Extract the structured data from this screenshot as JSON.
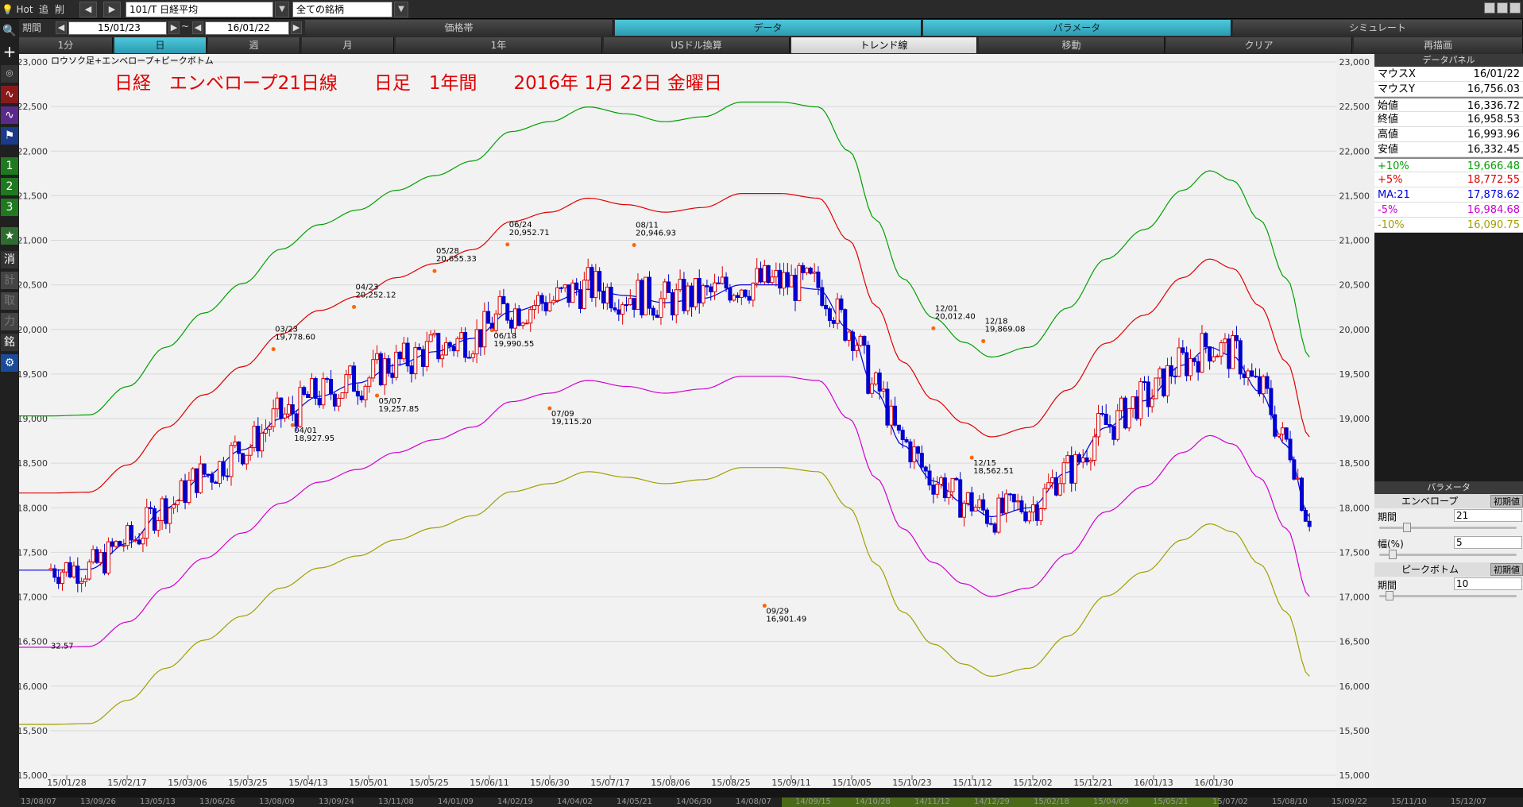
{
  "toolbar1": {
    "hot": "Hot",
    "add": "追",
    "del": "削",
    "symbol": "101/T 日経平均",
    "market_filter": "全ての銘柄"
  },
  "toolbar2": {
    "period_label": "期間",
    "from_date": "15/01/23",
    "tilde": "~",
    "to_date": "16/01/22",
    "tabs": [
      "価格帯",
      "データ",
      "パラメータ",
      "シミュレート"
    ]
  },
  "toolbar3": {
    "tabs": [
      "1分",
      "日",
      "週",
      "月",
      "1年",
      "USドル換算",
      "トレンド線",
      "移動",
      "クリア",
      "再描画"
    ]
  },
  "chart_data": {
    "type": "candlestick",
    "indicator_label": "ロウソク足+エンベロープ+ピークボトム",
    "title": "日経　エンベロープ21日線　　日足　1年間　　2016年 1月 22日 金曜日",
    "ylim": [
      15000,
      23000
    ],
    "y_ticks": [
      15000,
      15500,
      16000,
      16500,
      17000,
      17500,
      18000,
      18500,
      19000,
      19500,
      20000,
      20500,
      21000,
      21500,
      22000,
      22500,
      23000
    ],
    "x_tick_labels": [
      "15/01/28",
      "15/02/17",
      "15/03/06",
      "15/03/25",
      "15/04/13",
      "15/05/01",
      "15/05/25",
      "15/06/11",
      "15/06/30",
      "15/07/17",
      "15/08/06",
      "15/08/25",
      "15/09/11",
      "15/10/05",
      "15/10/23",
      "15/11/12",
      "15/12/02",
      "15/12/21",
      "16/01/13",
      "16/01/30"
    ],
    "bottom_row_labels": [
      "13/08/07",
      "13/09/26",
      "13/05/13",
      "13/06/26",
      "13/08/09",
      "13/09/24",
      "13/11/08",
      "14/01/09",
      "14/02/19",
      "14/04/02",
      "14/05/21",
      "14/06/30",
      "14/08/07",
      "14/09/15",
      "14/10/28",
      "14/11/12",
      "14/12/29",
      "15/02/18",
      "15/04/09",
      "15/05/21",
      "15/07/02",
      "15/08/10",
      "15/09/22",
      "15/11/10",
      "15/12/07"
    ],
    "left_cut_label": "32.57",
    "bands": {
      "plus10": {
        "name": "+10%",
        "color": "#00a000"
      },
      "plus5": {
        "name": "+5%",
        "color": "#e00000"
      },
      "ma21": {
        "name": "MA:21",
        "color": "#0000e0"
      },
      "minus5": {
        "name": "-5%",
        "color": "#d000d0"
      },
      "minus10": {
        "name": "-10%",
        "color": "#a0a000"
      }
    },
    "ma_points": [
      [
        0,
        17300
      ],
      [
        10,
        17310
      ],
      [
        20,
        17600
      ],
      [
        30,
        18000
      ],
      [
        40,
        18350
      ],
      [
        50,
        18650
      ],
      [
        60,
        19000
      ],
      [
        70,
        19250
      ],
      [
        80,
        19400
      ],
      [
        90,
        19600
      ],
      [
        100,
        19750
      ],
      [
        110,
        19900
      ],
      [
        120,
        20200
      ],
      [
        130,
        20300
      ],
      [
        140,
        20450
      ],
      [
        150,
        20380
      ],
      [
        160,
        20300
      ],
      [
        170,
        20350
      ],
      [
        180,
        20500
      ],
      [
        190,
        20500
      ],
      [
        200,
        20450
      ],
      [
        208,
        20000
      ],
      [
        215,
        19300
      ],
      [
        222,
        18700
      ],
      [
        230,
        18300
      ],
      [
        238,
        18050
      ],
      [
        245,
        17900
      ],
      [
        255,
        18000
      ],
      [
        265,
        18400
      ],
      [
        275,
        18900
      ],
      [
        285,
        19200
      ],
      [
        295,
        19600
      ],
      [
        302,
        19800
      ],
      [
        308,
        19700
      ],
      [
        315,
        19300
      ],
      [
        322,
        18700
      ],
      [
        328,
        17900
      ]
    ],
    "peaks": [
      {
        "date": "03/23",
        "value": "19,778.60",
        "i": 58,
        "v": 19778.6,
        "type": "peak"
      },
      {
        "date": "04/01",
        "value": "18,927.95",
        "i": 63,
        "v": 18927.95,
        "type": "bottom"
      },
      {
        "date": "04/23",
        "value": "20,252.12",
        "i": 79,
        "v": 20252.12,
        "type": "peak"
      },
      {
        "date": "05/07",
        "value": "19,257.85",
        "i": 85,
        "v": 19257.85,
        "type": "bottom"
      },
      {
        "date": "05/28",
        "value": "20,655.33",
        "i": 100,
        "v": 20655.33,
        "type": "peak"
      },
      {
        "date": "06/18",
        "value": "19,990.55",
        "i": 115,
        "v": 19990.55,
        "type": "bottom"
      },
      {
        "date": "06/24",
        "value": "20,952.71",
        "i": 119,
        "v": 20952.71,
        "type": "peak"
      },
      {
        "date": "07/09",
        "value": "19,115.20",
        "i": 130,
        "v": 19115.2,
        "type": "bottom"
      },
      {
        "date": "08/11",
        "value": "20,946.93",
        "i": 152,
        "v": 20946.93,
        "type": "peak"
      },
      {
        "date": "09/29",
        "value": "16,901.49",
        "i": 186,
        "v": 16901.49,
        "type": "bottom"
      },
      {
        "date": "12/01",
        "value": "20,012.40",
        "i": 230,
        "v": 20012.4,
        "type": "peak"
      },
      {
        "date": "12/15",
        "value": "18,562.51",
        "i": 240,
        "v": 18562.51,
        "type": "bottom"
      },
      {
        "date": "12/18",
        "value": "19,869.08",
        "i": 243,
        "v": 19869.08,
        "type": "peak"
      }
    ]
  },
  "data_panel": {
    "title": "データパネル",
    "rows": [
      {
        "k": "マウスX",
        "v": "16/01/22",
        "color": "#000"
      },
      {
        "k": "マウスY",
        "v": "16,756.03",
        "color": "#000"
      },
      {
        "k": "始値",
        "v": "16,336.72",
        "color": "#000"
      },
      {
        "k": "終値",
        "v": "16,958.53",
        "color": "#000"
      },
      {
        "k": "高値",
        "v": "16,993.96",
        "color": "#000"
      },
      {
        "k": "安値",
        "v": "16,332.45",
        "color": "#000"
      },
      {
        "k": "+10%",
        "v": "19,666.48",
        "color": "#00a000"
      },
      {
        "k": "+5%",
        "v": "18,772.55",
        "color": "#e00000"
      },
      {
        "k": "MA:21",
        "v": "17,878.62",
        "color": "#0000e0"
      },
      {
        "k": "-5%",
        "v": "16,984.68",
        "color": "#d000d0"
      },
      {
        "k": "-10%",
        "v": "16,090.75",
        "color": "#a0a000"
      }
    ]
  },
  "param_panel": {
    "title": "パラメータ",
    "envelope": "エンベロープ",
    "reset": "初期値",
    "period": "期間",
    "period_val": "21",
    "width": "幅(%)",
    "width_val": "5",
    "peakbottom": "ピークボトム",
    "reset2": "初期値",
    "period2": "期間",
    "period2_val": "10"
  },
  "side_icons": [
    "search-icon",
    "plus-icon",
    "camera-icon",
    "chart-icon",
    "chart2-icon",
    "flag-icon",
    "1",
    "2",
    "3",
    "star-icon",
    "消",
    "計",
    "取",
    "力",
    "銘",
    "gear-icon"
  ]
}
